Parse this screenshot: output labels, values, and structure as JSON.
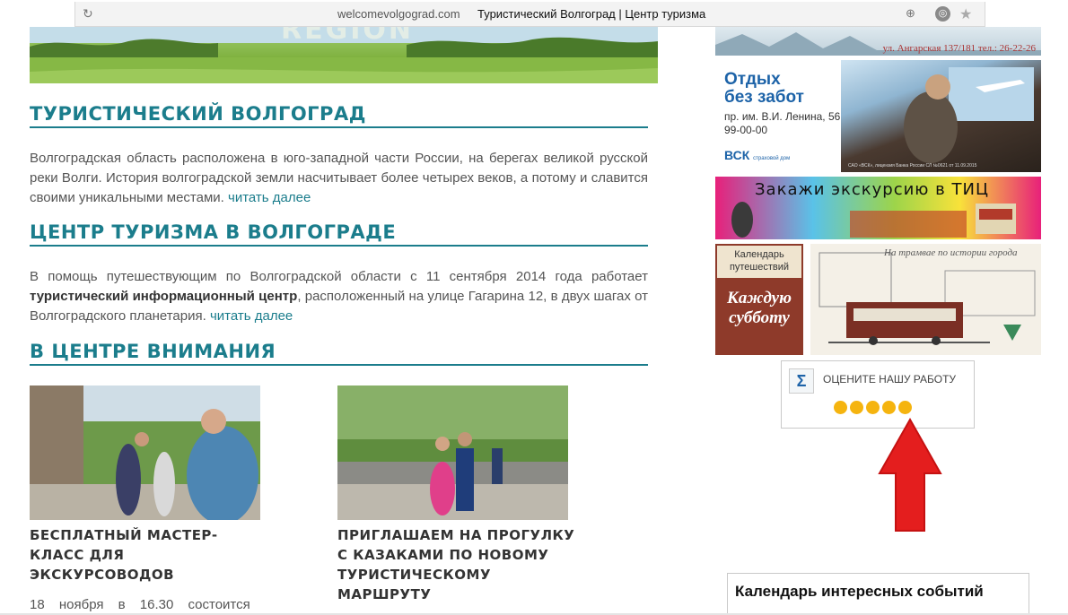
{
  "browser": {
    "domain": "welcomevolgograd.com",
    "page_title": "Туристический Волгоград | Центр туризма",
    "reload_icon": "reload-icon",
    "zoom_icon": "zoom-icon",
    "extension_icon": "extension-icon",
    "star_icon": "bookmark-star-icon"
  },
  "hero": {
    "word": "REGION"
  },
  "section1": {
    "heading": "Туристический Волгоград",
    "text": "Волгоградская область расположена в юго-западной части России, на берегах великой русской реки Волги. История волгоградской земли насчитывает более четырех веков, а потому и славится своими уникальными местами.",
    "read_more": "читать далее"
  },
  "section2": {
    "heading": "Центр туризма в Волгограде",
    "text_before": "В помощь путешествующим по Волгоградской области с 11 сентября 2014 года работает",
    "text_bold": "туристический информационный центр",
    "text_after": ", расположенный на улице Гагарина 12, в двух шагах от Волгоградского планетария.",
    "read_more": "читать далее"
  },
  "section3": {
    "heading": "В центре внимания"
  },
  "news": [
    {
      "title_lines": [
        "Бесплатный мастер-",
        "класс для",
        "экскурсоводов"
      ]
    },
    {
      "title_lines": [
        "Приглашаем на прогулку",
        "с казаками по новому",
        "туристическому",
        "маршруту"
      ]
    }
  ],
  "news_teaser": "18 ноября в 16.30 состоится",
  "sidebar": {
    "top_banner_address": "ул. Ангарская 137/181 тел.: 26-22-26",
    "vsk": {
      "headline_1": "Отдых",
      "headline_2": "без забот",
      "address": "пр. им. В.И. Ленина, 56",
      "phone": "99-00-00",
      "logo": "ВСК",
      "logo_sub": "страховой дом",
      "fine_print": "САО «ВСК», лицензия Банка России СЛ №0621 от 11.09.2015"
    },
    "tic_banner": "Закажи экскурсию в ТИЦ",
    "calendar": {
      "label": "Календарь путешествий",
      "big_text_1": "Каждую",
      "big_text_2": "субботу",
      "script": "На трамвае по истории города"
    },
    "rating": {
      "label": "ОЦЕНИТЕ НАШУ РАБОТУ",
      "sigma": "Σ",
      "stars": 5,
      "color": "#f5b40f"
    },
    "events_title": "Календарь интересных событий"
  },
  "colors": {
    "accent": "#1b7d8c",
    "arrow": "#e41e1e",
    "vsk_blue": "#1d63a8"
  }
}
